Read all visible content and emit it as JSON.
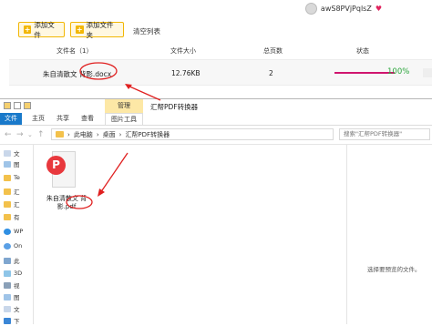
{
  "user": {
    "name": "awS8PVjPqlsZ"
  },
  "toolbar": {
    "add_file": "添加文件",
    "add_folder": "添加文件夹",
    "clear_list": "清空列表"
  },
  "table": {
    "headers": {
      "name": "文件名（1）",
      "size": "文件大小",
      "pages": "总页数",
      "status": "状态"
    },
    "row": {
      "name": "朱自清散文 背影.docx",
      "size": "12.76KB",
      "pages": "2",
      "progress": 100,
      "progress_label": "100%"
    }
  },
  "colors": {
    "accent_yellow": "#f2b705",
    "progress": "#d0156e",
    "percent_green": "#2aa53b",
    "annotation_red": "#e02020",
    "pdf_red": "#e8383d",
    "file_tab_blue": "#1979ca"
  },
  "explorer": {
    "manage_tab": "管理",
    "title": "汇帮PDF转换器",
    "tabs": [
      "文件",
      "主页",
      "共享",
      "查看",
      "图片工具"
    ],
    "breadcrumb": [
      "此电脑",
      "桌面",
      "汇帮PDF转换器"
    ],
    "search_placeholder": "搜索\"汇帮PDF转换器\"",
    "nav": [
      "文",
      "图",
      "Te",
      "汇",
      "汇",
      "有",
      "WP",
      "On",
      "此",
      "3D",
      "视",
      "图",
      "文",
      "下"
    ],
    "file": {
      "name": "朱自清散文 背影.pdf"
    },
    "preview_text": "选择要预览的文件。"
  },
  "icons": {
    "pdf": "pdf-file-icon",
    "folder": "folder-icon",
    "search": "search-icon"
  }
}
